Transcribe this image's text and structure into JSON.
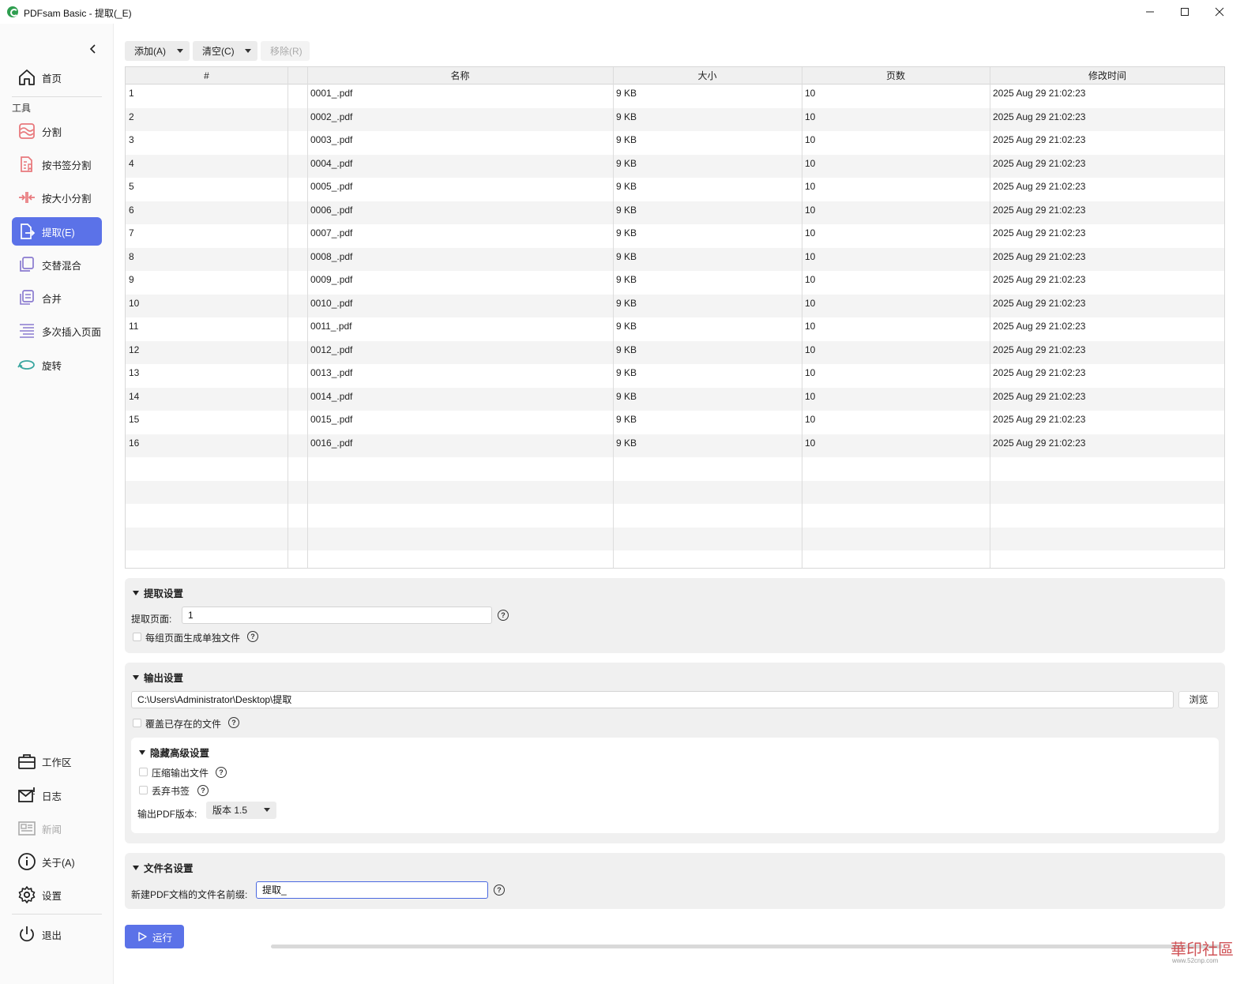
{
  "window": {
    "title": "PDFsam Basic - 提取(_E)"
  },
  "sidebar": {
    "home": "首页",
    "tools_label": "工具",
    "tools": [
      {
        "label": "分割",
        "icon": "split-icon"
      },
      {
        "label": "按书签分割",
        "icon": "bookmark-split-icon"
      },
      {
        "label": "按大小分割",
        "icon": "size-split-icon"
      },
      {
        "label": "提取(E)",
        "icon": "extract-icon"
      },
      {
        "label": "交替混合",
        "icon": "alternate-mix-icon"
      },
      {
        "label": "合并",
        "icon": "merge-icon"
      },
      {
        "label": "多次插入页面",
        "icon": "insert-pages-icon"
      },
      {
        "label": "旋转",
        "icon": "rotate-icon"
      }
    ],
    "bottom": [
      {
        "label": "工作区",
        "icon": "workspace-icon"
      },
      {
        "label": "日志",
        "icon": "log-icon"
      },
      {
        "label": "新闻",
        "icon": "news-icon"
      },
      {
        "label": "关于(A)",
        "icon": "about-icon"
      },
      {
        "label": "设置",
        "icon": "settings-icon"
      }
    ],
    "exit": "退出"
  },
  "toolbar": {
    "add": "添加(A)",
    "clear": "清空(C)",
    "remove": "移除(R)"
  },
  "table": {
    "headers": [
      "#",
      "",
      "名称",
      "大小",
      "页数",
      "修改时间"
    ],
    "rows": [
      [
        "1",
        "0001_.pdf",
        "9 KB",
        "10",
        "2025 Aug 29 21:02:23"
      ],
      [
        "2",
        "0002_.pdf",
        "9 KB",
        "10",
        "2025 Aug 29 21:02:23"
      ],
      [
        "3",
        "0003_.pdf",
        "9 KB",
        "10",
        "2025 Aug 29 21:02:23"
      ],
      [
        "4",
        "0004_.pdf",
        "9 KB",
        "10",
        "2025 Aug 29 21:02:23"
      ],
      [
        "5",
        "0005_.pdf",
        "9 KB",
        "10",
        "2025 Aug 29 21:02:23"
      ],
      [
        "6",
        "0006_.pdf",
        "9 KB",
        "10",
        "2025 Aug 29 21:02:23"
      ],
      [
        "7",
        "0007_.pdf",
        "9 KB",
        "10",
        "2025 Aug 29 21:02:23"
      ],
      [
        "8",
        "0008_.pdf",
        "9 KB",
        "10",
        "2025 Aug 29 21:02:23"
      ],
      [
        "9",
        "0009_.pdf",
        "9 KB",
        "10",
        "2025 Aug 29 21:02:23"
      ],
      [
        "10",
        "0010_.pdf",
        "9 KB",
        "10",
        "2025 Aug 29 21:02:23"
      ],
      [
        "11",
        "0011_.pdf",
        "9 KB",
        "10",
        "2025 Aug 29 21:02:23"
      ],
      [
        "12",
        "0012_.pdf",
        "9 KB",
        "10",
        "2025 Aug 29 21:02:23"
      ],
      [
        "13",
        "0013_.pdf",
        "9 KB",
        "10",
        "2025 Aug 29 21:02:23"
      ],
      [
        "14",
        "0014_.pdf",
        "9 KB",
        "10",
        "2025 Aug 29 21:02:23"
      ],
      [
        "15",
        "0015_.pdf",
        "9 KB",
        "10",
        "2025 Aug 29 21:02:23"
      ],
      [
        "16",
        "0016_.pdf",
        "9 KB",
        "10",
        "2025 Aug 29 21:02:23"
      ]
    ]
  },
  "extract_settings": {
    "title": "提取设置",
    "pages_label": "提取页面:",
    "pages_value": "1",
    "separate_label": "每组页面生成单独文件"
  },
  "output_settings": {
    "title": "输出设置",
    "path": "C:\\Users\\Administrator\\Desktop\\提取",
    "browse": "浏览",
    "overwrite_label": "覆盖已存在的文件",
    "advanced_title": "隐藏高级设置",
    "compress_label": "压缩输出文件",
    "discard_bookmarks_label": "丢弃书签",
    "pdf_version_label": "输出PDF版本:",
    "pdf_version_value": "版本 1.5"
  },
  "filename_settings": {
    "title": "文件名设置",
    "prefix_label": "新建PDF文档的文件名前缀:",
    "prefix_value": "提取_"
  },
  "run": {
    "label": "运行"
  },
  "watermark": {
    "text": "華印社區",
    "sub": "www.52cnp.com"
  },
  "colors": {
    "accent": "#5b72e8",
    "panel": "#f0f0f0"
  }
}
